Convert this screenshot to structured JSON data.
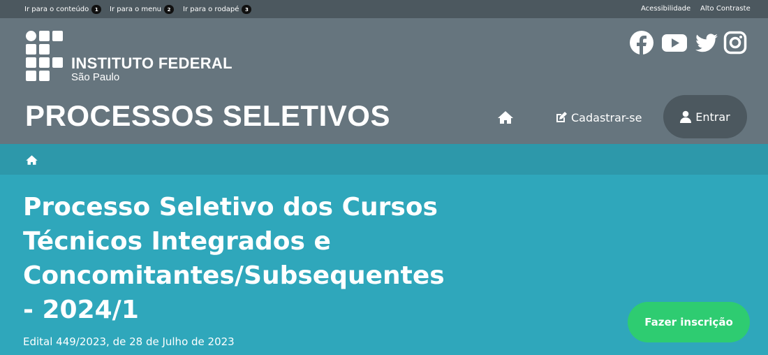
{
  "topbar": {
    "skip_links": [
      {
        "label": "Ir para o conteúdo",
        "key": "1"
      },
      {
        "label": "Ir para o menu",
        "key": "2"
      },
      {
        "label": "Ir para o rodapé",
        "key": "3"
      }
    ],
    "accessibility": "Acessibilidade",
    "high_contrast": "Alto Contraste"
  },
  "header": {
    "institution_name": "INSTITUTO FEDERAL",
    "institution_campus": "São Paulo",
    "site_title": "PROCESSOS SELETIVOS",
    "social": [
      "facebook-icon",
      "youtube-icon",
      "twitter-icon",
      "instagram-icon"
    ],
    "nav": {
      "home_icon": "home-icon",
      "register_label": "Cadastrar-se",
      "login_label": "Entrar"
    }
  },
  "breadcrumb": {
    "home_icon": "home-icon"
  },
  "main": {
    "title": "Processo Seletivo dos Cursos Técnicos Integrados e Concomitantes/Subsequentes - 2024/1",
    "edital": "Edital 449/2023, de 28 de Julho de 2023",
    "cta_label": "Fazer inscrição"
  },
  "colors": {
    "topbar_bg": "#4c585f",
    "header_bg": "#66757e",
    "breadcrumb_bg": "#2d98aa",
    "main_bg": "#2fa7bb",
    "cta_bg": "#2ecc71"
  }
}
